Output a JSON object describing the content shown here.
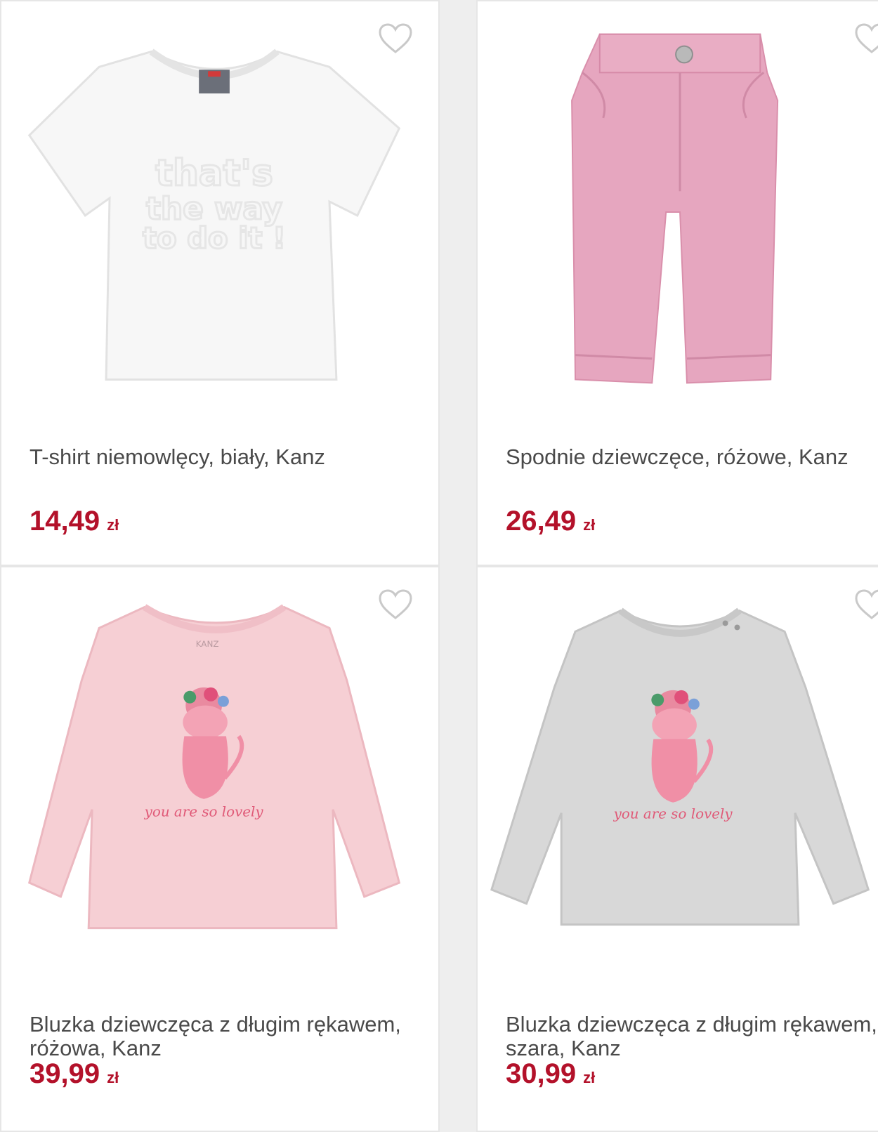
{
  "accent_color": "#b3112a",
  "products": [
    {
      "title": "T-shirt niemowlęcy, biały, Kanz",
      "price": "14,49",
      "currency": "zł",
      "print_text": "that's the way to do it !",
      "favorite_icon": "heart-outline-icon"
    },
    {
      "title": "Spodnie dziewczęce, różowe, Kanz",
      "price": "26,49",
      "currency": "zł",
      "favorite_icon": "heart-outline-icon"
    },
    {
      "title": "Bluzka dziewczęca z długim rękawem, różowa, Kanz",
      "price": "39,99",
      "currency": "zł",
      "print_text": "you are so lovely",
      "label_text": "KANZ",
      "favorite_icon": "heart-outline-icon"
    },
    {
      "title": "Bluzka dziewczęca z długim rękawem, szara, Kanz",
      "price": "30,99",
      "currency": "zł",
      "print_text": "you are so lovely",
      "favorite_icon": "heart-outline-icon"
    }
  ]
}
